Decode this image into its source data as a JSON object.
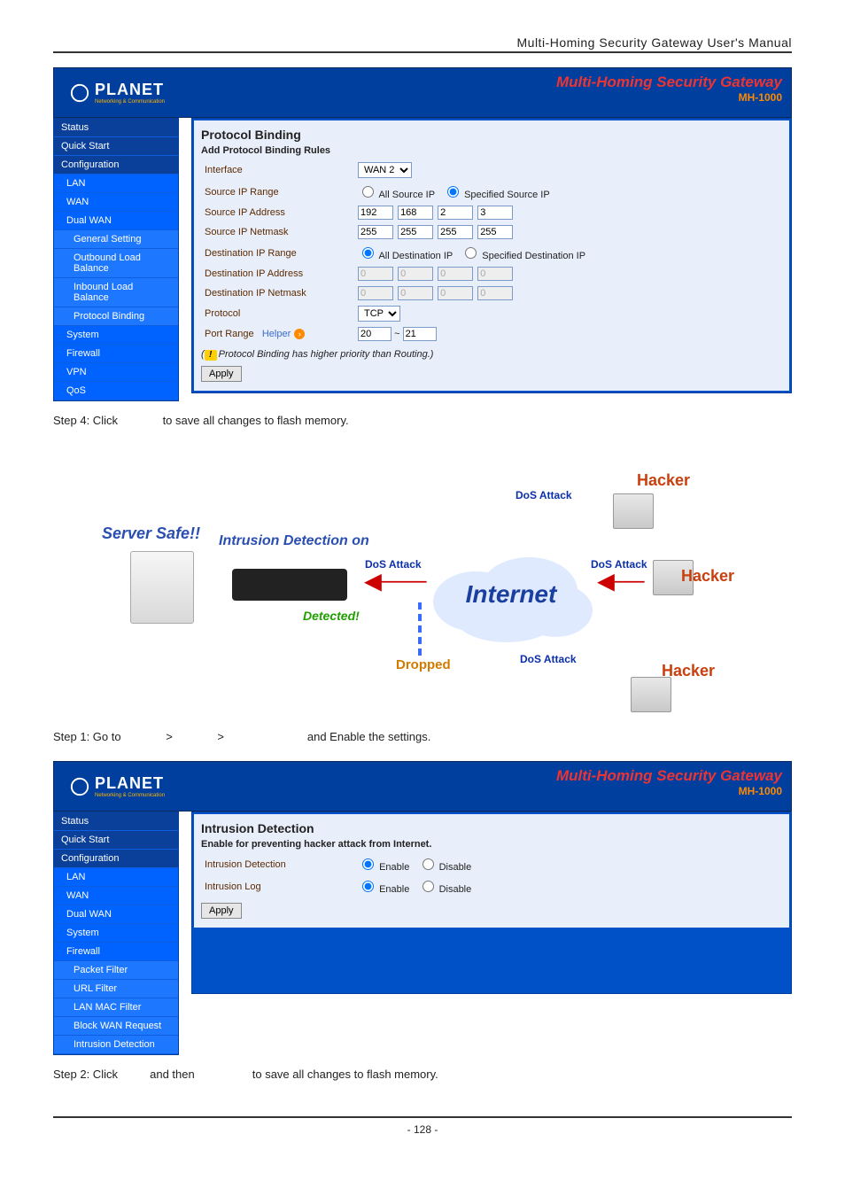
{
  "doc": {
    "header": "Multi-Homing Security Gateway User's Manual",
    "page_number": "- 128 -"
  },
  "banner": {
    "brand": "PLANET",
    "brand_sub": "Networking & Communication",
    "title": "Multi-Homing Security Gateway",
    "model": "MH-1000"
  },
  "sidebar1": {
    "items": [
      {
        "label": "Status",
        "lvl": "top"
      },
      {
        "label": "Quick Start",
        "lvl": "top"
      },
      {
        "label": "Configuration",
        "lvl": "top"
      },
      {
        "label": "LAN",
        "lvl": "lvl2"
      },
      {
        "label": "WAN",
        "lvl": "lvl2"
      },
      {
        "label": "Dual WAN",
        "lvl": "lvl2"
      },
      {
        "label": "General Setting",
        "lvl": "lvl3"
      },
      {
        "label": "Outbound Load Balance",
        "lvl": "lvl3"
      },
      {
        "label": "Inbound Load Balance",
        "lvl": "lvl3"
      },
      {
        "label": "Protocol Binding",
        "lvl": "lvl3"
      },
      {
        "label": "System",
        "lvl": "lvl2"
      },
      {
        "label": "Firewall",
        "lvl": "lvl2"
      },
      {
        "label": "VPN",
        "lvl": "lvl2"
      },
      {
        "label": "QoS",
        "lvl": "lvl2"
      }
    ]
  },
  "panel1": {
    "title": "Protocol Binding",
    "subhead": "Add Protocol Binding Rules",
    "rows": {
      "interface_label": "Interface",
      "interface_value": "WAN 2",
      "src_range_label": "Source IP Range",
      "src_range_opt_all": "All Source IP",
      "src_range_opt_spec": "Specified Source IP",
      "src_addr_label": "Source IP Address",
      "src_addr": [
        "192",
        "168",
        "2",
        "3"
      ],
      "src_mask_label": "Source IP Netmask",
      "src_mask": [
        "255",
        "255",
        "255",
        "255"
      ],
      "dst_range_label": "Destination IP Range",
      "dst_range_opt_all": "All Destination IP",
      "dst_range_opt_spec": "Specified Destination IP",
      "dst_addr_label": "Destination IP Address",
      "dst_addr": [
        "0",
        "0",
        "0",
        "0"
      ],
      "dst_mask_label": "Destination IP Netmask",
      "dst_mask": [
        "0",
        "0",
        "0",
        "0"
      ],
      "protocol_label": "Protocol",
      "protocol_value": "TCP",
      "port_label": "Port Range",
      "port_helper": "Helper",
      "port_from": "20",
      "port_sep": "~",
      "port_to": "21"
    },
    "note_prefix": "(",
    "note_icon": "!",
    "note_text": "Protocol Binding has higher priority than Routing.)",
    "apply": "Apply"
  },
  "steps": {
    "s4_a": "Step 4: Click ",
    "s4_b": " to save all changes to flash memory.",
    "s1_a": "Step 1: Go to ",
    "s1_gt": ">",
    "s1_b": " and Enable the settings.",
    "s2_a": "Step 2: Click ",
    "s2_mid": " and then ",
    "s2_b": " to save all changes to flash memory."
  },
  "diagram": {
    "server_safe": "Server Safe!!",
    "intrusion_on": "Intrusion Detection on",
    "dos_attack": "DoS Attack",
    "detected": "Detected!",
    "dropped": "Dropped",
    "internet": "Internet",
    "hacker": "Hacker"
  },
  "sidebar2": {
    "items": [
      {
        "label": "Status",
        "lvl": "top"
      },
      {
        "label": "Quick Start",
        "lvl": "top"
      },
      {
        "label": "Configuration",
        "lvl": "top"
      },
      {
        "label": "LAN",
        "lvl": "lvl2"
      },
      {
        "label": "WAN",
        "lvl": "lvl2"
      },
      {
        "label": "Dual WAN",
        "lvl": "lvl2"
      },
      {
        "label": "System",
        "lvl": "lvl2"
      },
      {
        "label": "Firewall",
        "lvl": "lvl2"
      },
      {
        "label": "Packet Filter",
        "lvl": "lvl3"
      },
      {
        "label": "URL Filter",
        "lvl": "lvl3"
      },
      {
        "label": "LAN MAC Filter",
        "lvl": "lvl3"
      },
      {
        "label": "Block WAN Request",
        "lvl": "lvl3"
      },
      {
        "label": "Intrusion Detection",
        "lvl": "lvl3"
      }
    ]
  },
  "panel2": {
    "title": "Intrusion Detection",
    "subhead": "Enable for preventing hacker attack from Internet.",
    "row1_label": "Intrusion Detection",
    "row2_label": "Intrusion Log",
    "enable": "Enable",
    "disable": "Disable",
    "apply": "Apply"
  }
}
